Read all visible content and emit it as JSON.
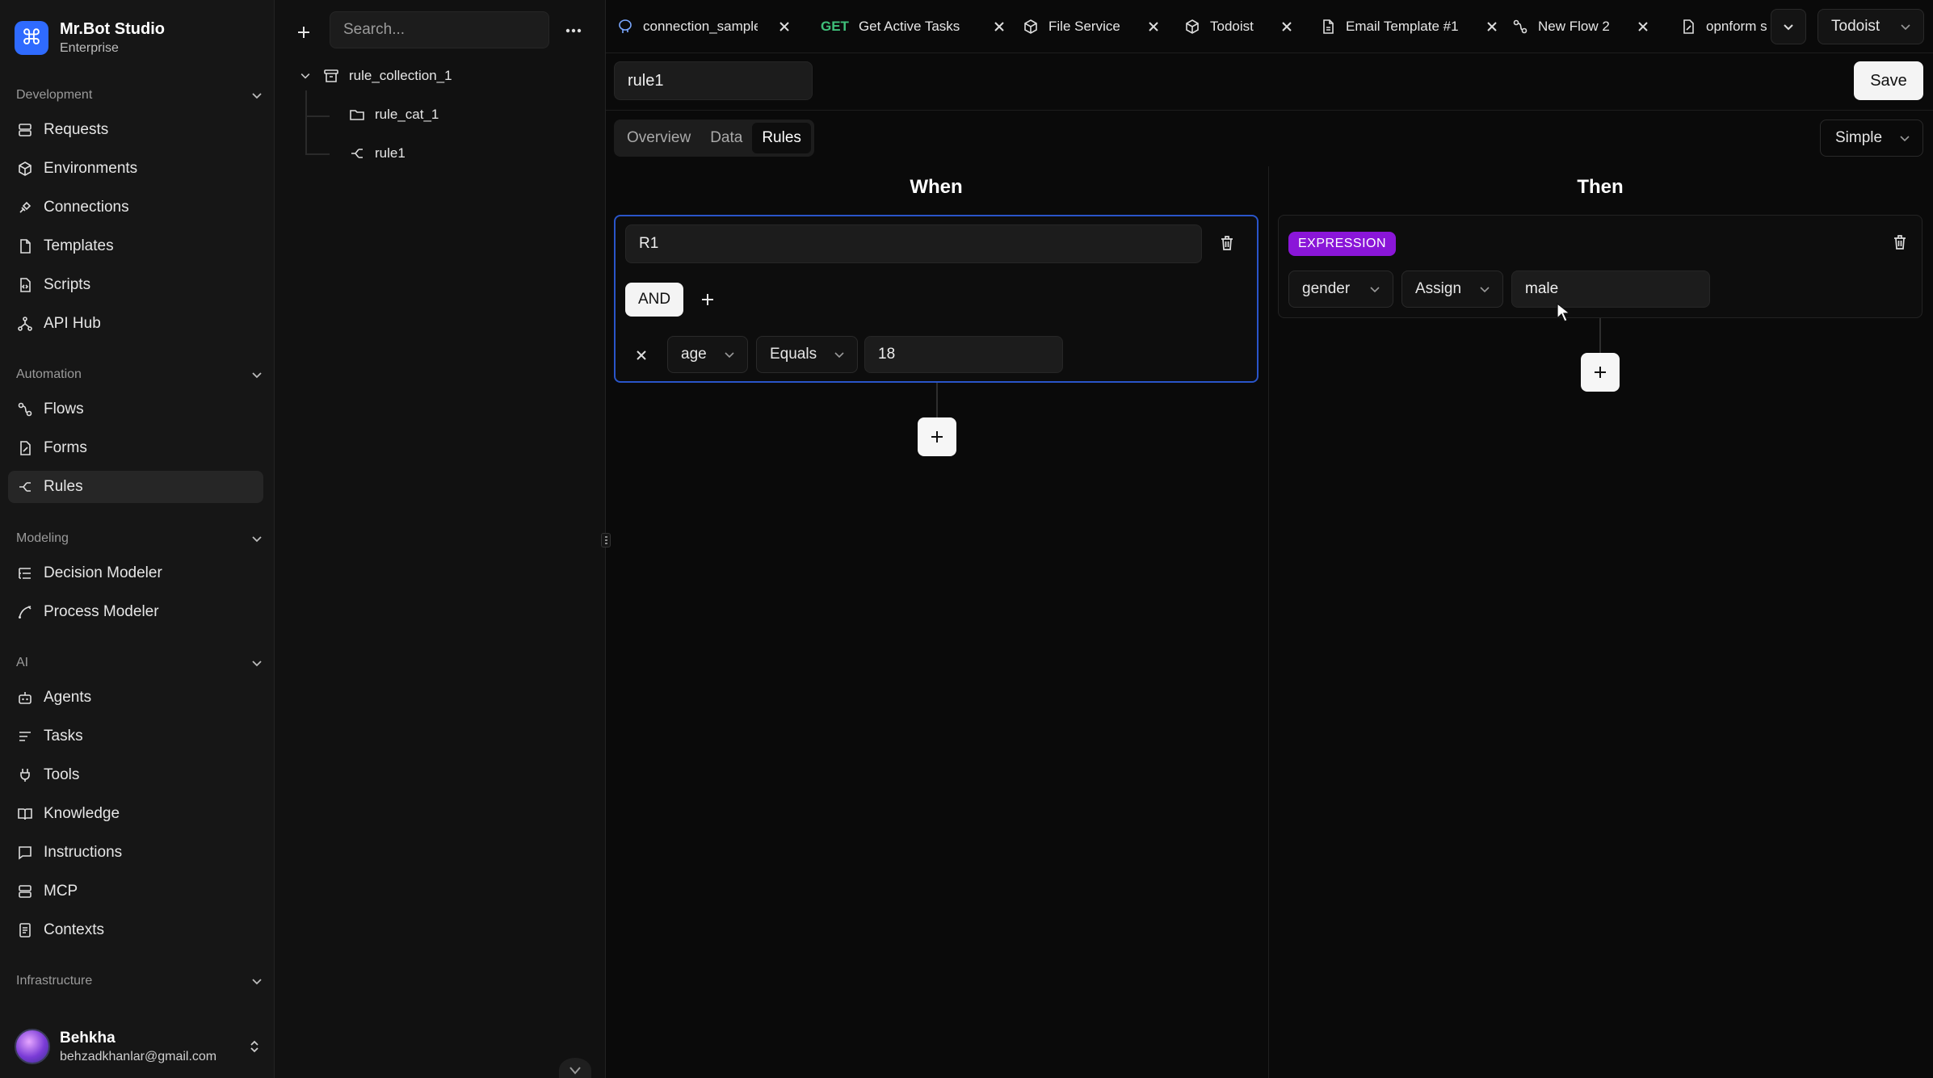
{
  "brand": {
    "name": "Mr.Bot Studio",
    "plan": "Enterprise"
  },
  "sidebar": {
    "sections": [
      {
        "title": "Development",
        "items": [
          "Requests",
          "Environments",
          "Connections",
          "Templates",
          "Scripts",
          "API Hub"
        ]
      },
      {
        "title": "Automation",
        "items": [
          "Flows",
          "Forms",
          "Rules"
        ]
      },
      {
        "title": "Modeling",
        "items": [
          "Decision Modeler",
          "Process Modeler"
        ]
      },
      {
        "title": "AI",
        "items": [
          "Agents",
          "Tasks",
          "Tools",
          "Knowledge",
          "Instructions",
          "MCP",
          "Contexts"
        ]
      },
      {
        "title": "Infrastructure",
        "items": []
      }
    ],
    "active_item": "Rules"
  },
  "user": {
    "name": "Behkha",
    "email": "behzadkhanlar@gmail.com"
  },
  "explorer": {
    "search_placeholder": "Search...",
    "tree": {
      "collection": "rule_collection_1",
      "category": "rule_cat_1",
      "rule": "rule1"
    }
  },
  "tabs": [
    {
      "label": "connection_sample",
      "method": "",
      "icon": "postgres-icon"
    },
    {
      "label": "Get Active Tasks",
      "method": "GET",
      "icon": ""
    },
    {
      "label": "File Service",
      "method": "",
      "icon": "box-icon"
    },
    {
      "label": "Todoist",
      "method": "",
      "icon": "box-icon"
    },
    {
      "label": "Email Template #1",
      "method": "",
      "icon": "file-icon"
    },
    {
      "label": "New Flow 2",
      "method": "",
      "icon": "flow-icon"
    },
    {
      "label": "opnform s",
      "method": "",
      "icon": "file-icon"
    }
  ],
  "workspace_select": "Todoist",
  "editor": {
    "name_value": "rule1",
    "save_label": "Save",
    "view_tabs": [
      "Overview",
      "Data",
      "Rules"
    ],
    "active_view": "Rules",
    "mode": "Simple"
  },
  "when": {
    "title": "When",
    "rule_name": "R1",
    "logic": "AND",
    "condition": {
      "field": "age",
      "operator": "Equals",
      "value": "18"
    }
  },
  "then": {
    "title": "Then",
    "badge": "EXPRESSION",
    "action": {
      "field": "gender",
      "operator": "Assign",
      "value": "male"
    }
  },
  "colors": {
    "accent": "#2f6bff",
    "expression_badge": "#8a16d8",
    "selection_border": "#2a55c9",
    "get_method": "#3fc07a"
  }
}
